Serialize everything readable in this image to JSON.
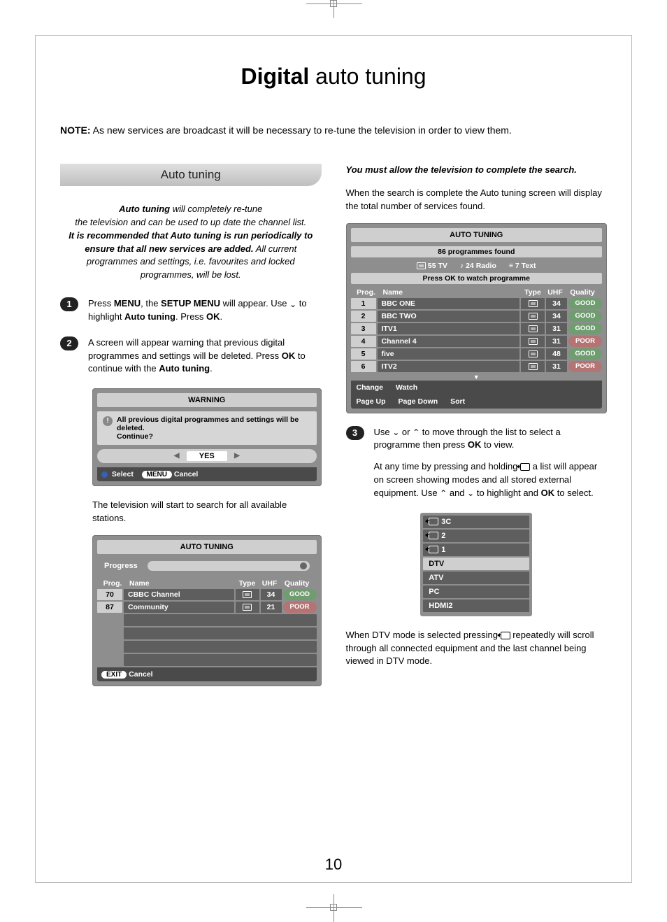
{
  "title_bold": "Digital",
  "title_rest": " auto tuning",
  "note_label": "NOTE:",
  "note_text": " As new services are broadcast it will be necessary to re-tune the television in order to view them.",
  "section_header": "Auto tuning",
  "intro": {
    "l1a": "Auto tuning",
    "l1b": " will completely re-tune",
    "l2": "the television and can be used to up date the channel list.",
    "l3": "It is recommended that Auto tuning is run periodically to ensure that all new services are added.",
    "l4": " All current programmes and settings, i.e. favourites and locked programmes, will be lost."
  },
  "steps": {
    "s1": "1",
    "s1_a": "Press ",
    "s1_b": "MENU",
    "s1_c": ", the ",
    "s1_d": "SETUP MENU",
    "s1_e": " will appear. Use ",
    "s1_f": " to highlight ",
    "s1_g": "Auto tuning",
    "s1_h": ". Press ",
    "s1_i": "OK",
    "s1_j": ".",
    "s2": "2",
    "s2_a": "A screen will appear warning that previous digital programmes and settings will be deleted. Press ",
    "s2_b": "OK",
    "s2_c": " to continue with the ",
    "s2_d": "Auto tuning",
    "s2_e": ".",
    "s3": "3",
    "s3_a": "Use ",
    "s3_b": " or ",
    "s3_c": " to move through the list to select a programme then press ",
    "s3_d": "OK",
    "s3_e": " to view.",
    "s3_f": "At any time by pressing and holding ",
    "s3_g": " a list will appear on screen showing modes and all stored external equipment. Use ",
    "s3_h": " and ",
    "s3_i": " to highlight and ",
    "s3_j": "OK",
    "s3_k": " to select."
  },
  "warning_osd": {
    "title": "WARNING",
    "msg1": "All previous digital programmes and settings will be deleted.",
    "msg2": "Continue?",
    "yes": "YES",
    "select": "Select",
    "menu": "MENU",
    "cancel": "Cancel"
  },
  "post_osd1": "The television will start to search for all available stations.",
  "progress_osd": {
    "title": "AUTO TUNING",
    "progress": "Progress",
    "h_prog": "Prog.",
    "h_name": "Name",
    "h_type": "Type",
    "h_uhf": "UHF",
    "h_qual": "Quality",
    "rows": [
      {
        "prog": "70",
        "name": "CBBC Channel",
        "uhf": "34",
        "qual": "GOOD",
        "qc": "q-good"
      },
      {
        "prog": "87",
        "name": "Community",
        "uhf": "21",
        "qual": "POOR",
        "qc": "q-poor"
      }
    ],
    "exit": "EXIT",
    "cancel": "Cancel"
  },
  "right_intro": {
    "l1": "You must allow the television to complete the search.",
    "l2a": "When the search is complete the ",
    "l2b": "Auto tuning",
    "l2c": " screen will display the total number of services found."
  },
  "results_osd": {
    "title": "AUTO TUNING",
    "found": "86 programmes found",
    "tv": "55  TV",
    "radio": "24  Radio",
    "text": "7  Text",
    "hint": "Press OK to watch programme",
    "h_prog": "Prog.",
    "h_name": "Name",
    "h_type": "Type",
    "h_uhf": "UHF",
    "h_qual": "Quality",
    "rows": [
      {
        "prog": "1",
        "name": "BBC ONE",
        "uhf": "34",
        "qual": "GOOD",
        "qc": "q-good"
      },
      {
        "prog": "2",
        "name": "BBC TWO",
        "uhf": "34",
        "qual": "GOOD",
        "qc": "q-good"
      },
      {
        "prog": "3",
        "name": "ITV1",
        "uhf": "31",
        "qual": "GOOD",
        "qc": "q-good"
      },
      {
        "prog": "4",
        "name": "Channel 4",
        "uhf": "31",
        "qual": "POOR",
        "qc": "q-poor"
      },
      {
        "prog": "5",
        "name": "five",
        "uhf": "48",
        "qual": "GOOD",
        "qc": "q-good"
      },
      {
        "prog": "6",
        "name": "ITV2",
        "uhf": "31",
        "qual": "POOR",
        "qc": "q-poor"
      }
    ],
    "change": "Change",
    "watch": "Watch",
    "pageup": "Page Up",
    "pagedown": "Page Down",
    "sort": "Sort"
  },
  "sources": [
    "3C",
    "2",
    "1",
    "DTV",
    "ATV",
    "PC",
    "HDMI2"
  ],
  "source_sel_index": 3,
  "post_src_a": "When ",
  "post_src_b": "DTV",
  "post_src_c": " mode is selected pressing ",
  "post_src_d": " repeatedly will scroll through all connected equipment and the last channel being viewed in DTV mode.",
  "page_number": "10"
}
